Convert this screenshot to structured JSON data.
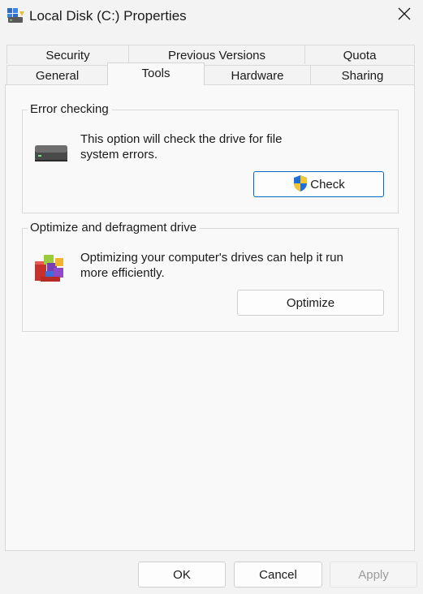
{
  "window": {
    "title": "Local Disk (C:) Properties",
    "close_icon": "close-icon",
    "drive_icon": "drive-with-network-icon"
  },
  "tabs": {
    "row1": [
      {
        "label": "Security"
      },
      {
        "label": "Previous Versions"
      },
      {
        "label": "Quota"
      }
    ],
    "row2": [
      {
        "label": "General"
      },
      {
        "label": "Tools",
        "active": true
      },
      {
        "label": "Hardware"
      },
      {
        "label": "Sharing"
      }
    ]
  },
  "error_checking": {
    "legend": "Error checking",
    "icon": "hard-drive-icon",
    "description_line1": "This option will check the drive for file",
    "description_line2": "system errors.",
    "check_button": "Check",
    "check_icon": "uac-shield-icon"
  },
  "optimize": {
    "legend": "Optimize and defragment drive",
    "icon": "defrag-blocks-icon",
    "description_line1": "Optimizing your computer's drives can help it run",
    "description_line2": "more efficiently.",
    "optimize_button": "Optimize"
  },
  "footer": {
    "ok": "OK",
    "cancel": "Cancel",
    "apply": "Apply"
  },
  "colors": {
    "accent": "#0067c0",
    "window_bg": "#f3f3f3",
    "panel_bg": "#f9f9f9"
  }
}
